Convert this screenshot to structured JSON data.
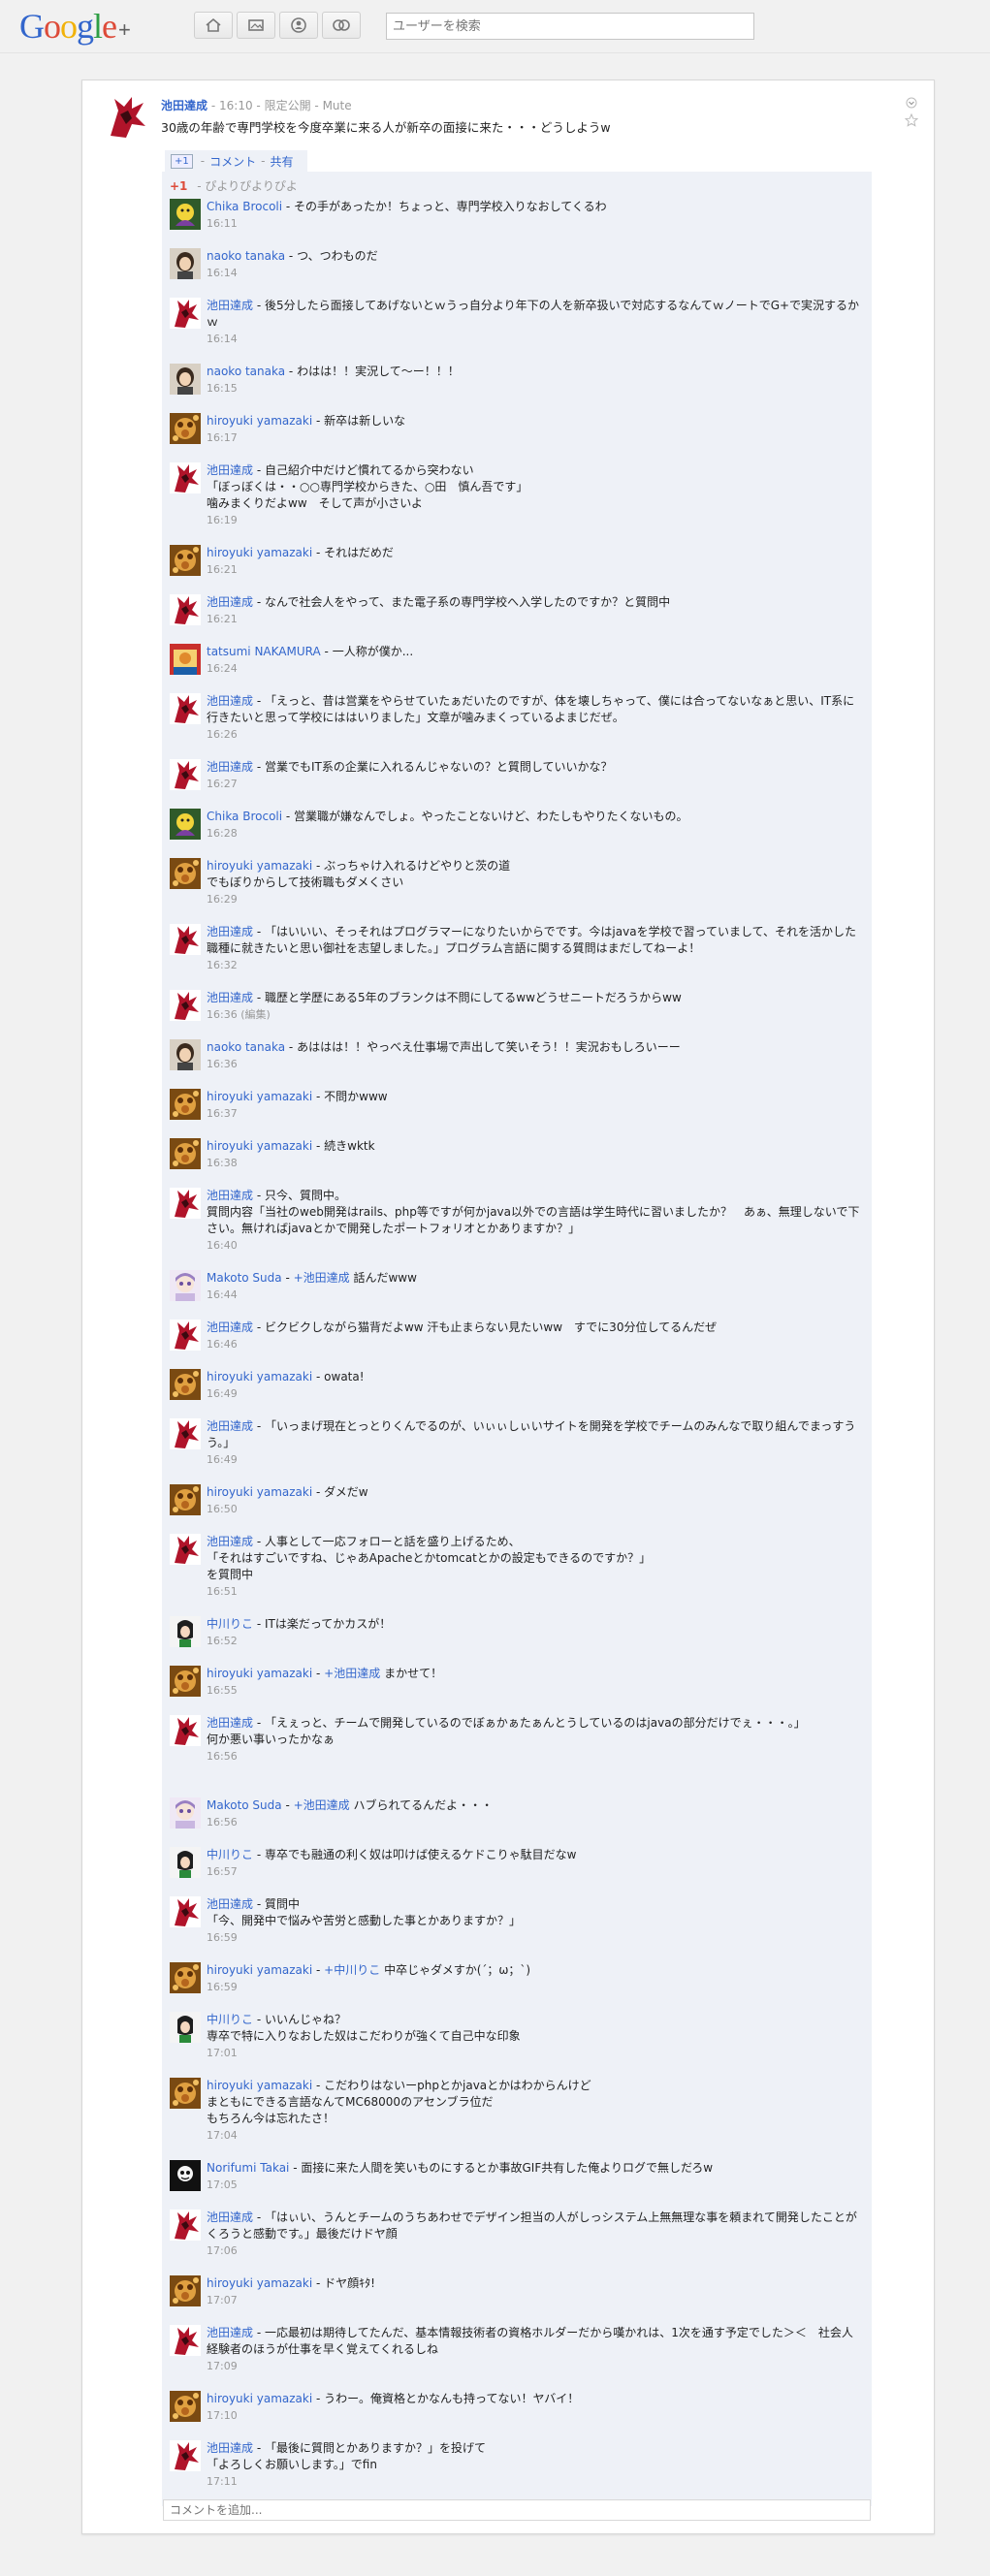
{
  "header": {
    "logo_letters": [
      "G",
      "o",
      "o",
      "g",
      "l",
      "e"
    ],
    "logo_colors": [
      "#3366cc",
      "#dd4b39",
      "#f1b20a",
      "#3366cc",
      "#2e9e44",
      "#dd4b39"
    ],
    "logo_plus": "+",
    "nav_icons": [
      "home-icon",
      "photos-icon",
      "profile-icon",
      "circles-icon"
    ],
    "search_placeholder": "ユーザーを検索"
  },
  "post": {
    "author": "池田達成",
    "time": "16:10",
    "visibility": "限定公開",
    "mute": "Mute",
    "text": "30歳の年齢で専門学校を今度卒業に来る人が新卒の面接に来た・・・どうしようw",
    "plusone_label": "+1",
    "comment_link": "コメント",
    "share_link": "共有",
    "plusones_label": "+1",
    "plusones_names": "ぴよりぴよりぴよ"
  },
  "comment_input_placeholder": "コメントを追加...",
  "comments": [
    {
      "author": "Chika Brocoli",
      "avatar": "chika",
      "mention": "",
      "lines": [
        "その手があったか！ちょっと、専門学校入りなおしてくるわ"
      ],
      "time": "16:11"
    },
    {
      "author": "naoko tanaka",
      "avatar": "naoko",
      "mention": "",
      "lines": [
        "つ、つわものだ"
      ],
      "time": "16:14"
    },
    {
      "author": "池田達成",
      "avatar": "ikeda",
      "mention": "",
      "lines": [
        "後5分したら面接してあげないとｗうっ自分より年下の人を新卒扱いで対応するなんてｗノートでG+で実況するかｗ"
      ],
      "time": "16:14"
    },
    {
      "author": "naoko tanaka",
      "avatar": "naoko",
      "mention": "",
      "lines": [
        "わはは！！実況して〜ー！！！"
      ],
      "time": "16:15"
    },
    {
      "author": "hiroyuki yamazaki",
      "avatar": "hiroyuki",
      "mention": "",
      "lines": [
        "新卒は新しいな"
      ],
      "time": "16:17"
    },
    {
      "author": "池田達成",
      "avatar": "ikeda",
      "mention": "",
      "lines": [
        "自己紹介中だけど慣れてるから突わない",
        "「ぼっぼくは・・○○専門学校からきた、○田　慎ん吾です」",
        "噛みまくりだよww　そして声が小さいよ"
      ],
      "time": "16:19"
    },
    {
      "author": "hiroyuki yamazaki",
      "avatar": "hiroyuki",
      "mention": "",
      "lines": [
        "それはだめだ"
      ],
      "time": "16:21"
    },
    {
      "author": "池田達成",
      "avatar": "ikeda",
      "mention": "",
      "lines": [
        "なんで社会人をやって、また電子系の専門学校へ入学したのですか？と質問中"
      ],
      "time": "16:21"
    },
    {
      "author": "tatsumi NAKAMURA",
      "avatar": "tatsumi",
      "mention": "",
      "lines": [
        "一人称が僕か..."
      ],
      "time": "16:24"
    },
    {
      "author": "池田達成",
      "avatar": "ikeda",
      "mention": "",
      "lines": [
        "「えっと、昔は営業をやらせていたぁだいたのですが、体を壊しちゃって、僕には合ってないなぁと思い、IT系に行きたいと思って学校にははいりました」文章が噛みまくっているよまじだぜ。"
      ],
      "time": "16:26"
    },
    {
      "author": "池田達成",
      "avatar": "ikeda",
      "mention": "",
      "lines": [
        "営業でもIT系の企業に入れるんじゃないの？と質問していいかな？"
      ],
      "time": "16:27"
    },
    {
      "author": "Chika Brocoli",
      "avatar": "chika",
      "mention": "",
      "lines": [
        "営業職が嫌なんでしょ。やったことないけど、わたしもやりたくないもの。"
      ],
      "time": "16:28"
    },
    {
      "author": "hiroyuki yamazaki",
      "avatar": "hiroyuki",
      "mention": "",
      "lines": [
        "ぶっちゃけ入れるけどやりと茨の道",
        "でもぼりからして技術職もダメくさい"
      ],
      "time": "16:29"
    },
    {
      "author": "池田達成",
      "avatar": "ikeda",
      "mention": "",
      "lines": [
        "「はいいい、そっそれはプログラマーになりたいからでです。今はjavaを学校で習っていまして、それを活かした職種に就きたいと思い御社を志望しました。」プログラム言語に関する質問はまだしてねーよ！"
      ],
      "time": "16:32"
    },
    {
      "author": "池田達成",
      "avatar": "ikeda",
      "mention": "",
      "lines": [
        "職歴と学歴にある5年のブランクは不問にしてるwwどうせニートだろうからww"
      ],
      "time": "16:36 (編集)"
    },
    {
      "author": "naoko tanaka",
      "avatar": "naoko",
      "mention": "",
      "lines": [
        "あははは！！やっべえ仕事場で声出して笑いそう！！実況おもしろいーー"
      ],
      "time": "16:36"
    },
    {
      "author": "hiroyuki yamazaki",
      "avatar": "hiroyuki",
      "mention": "",
      "lines": [
        "不問かwww"
      ],
      "time": "16:37"
    },
    {
      "author": "hiroyuki yamazaki",
      "avatar": "hiroyuki",
      "mention": "",
      "lines": [
        "続きwktk"
      ],
      "time": "16:38"
    },
    {
      "author": "池田達成",
      "avatar": "ikeda",
      "mention": "",
      "lines": [
        "只今、質問中。",
        "質問内容「当社のweb開発はrails、php等ですが何かjava以外での言語は学生時代に習いましたか？　あぁ、無理しないで下さい。無ければjavaとかで開発したポートフォリオとかありますか？」"
      ],
      "time": "16:40"
    },
    {
      "author": "Makoto Suda",
      "avatar": "makoto",
      "mention": "+池田達成",
      "lines": [
        "話んだwww"
      ],
      "time": "16:44"
    },
    {
      "author": "池田達成",
      "avatar": "ikeda",
      "mention": "",
      "lines": [
        "ビクビクしながら猫背だよww 汗も止まらない見たいww　すでに30分位してるんだぜ"
      ],
      "time": "16:46"
    },
    {
      "author": "hiroyuki yamazaki",
      "avatar": "hiroyuki",
      "mention": "",
      "lines": [
        "owata!"
      ],
      "time": "16:49"
    },
    {
      "author": "池田達成",
      "avatar": "ikeda",
      "mention": "",
      "lines": [
        "「いっまげ現在とっとりくんでるのが、いぃぃしぃいサイトを開発を学校でチームのみんなで取り組んでまっすうう。」"
      ],
      "time": "16:49"
    },
    {
      "author": "hiroyuki yamazaki",
      "avatar": "hiroyuki",
      "mention": "",
      "lines": [
        "ダメだw"
      ],
      "time": "16:50"
    },
    {
      "author": "池田達成",
      "avatar": "ikeda",
      "mention": "",
      "lines": [
        "人事として一応フォローと話を盛り上げるため、",
        "「それはすごいですね、じゃあApacheとかtomcatとかの設定もできるのですか？」",
        "を質問中"
      ],
      "time": "16:51"
    },
    {
      "author": "中川りこ",
      "avatar": "riko",
      "mention": "",
      "lines": [
        "ITは楽だってかカスが！"
      ],
      "time": "16:52"
    },
    {
      "author": "hiroyuki yamazaki",
      "avatar": "hiroyuki",
      "mention": "+池田達成",
      "lines": [
        "まかせて！"
      ],
      "time": "16:55"
    },
    {
      "author": "池田達成",
      "avatar": "ikeda",
      "mention": "",
      "lines": [
        "「えぇっと、チームで開発しているのでぼぁかぁたぁんとうしているのはjavaの部分だけでぇ・・・。」",
        "何か悪い事いったかなぁ"
      ],
      "time": "16:56"
    },
    {
      "author": "Makoto Suda",
      "avatar": "makoto",
      "mention": "+池田達成",
      "lines": [
        "ハブられてるんだよ・・・"
      ],
      "time": "16:56"
    },
    {
      "author": "中川りこ",
      "avatar": "riko",
      "mention": "",
      "lines": [
        "専卒でも融通の利く奴は叩けば使えるケドこりゃ駄目だなw"
      ],
      "time": "16:57"
    },
    {
      "author": "池田達成",
      "avatar": "ikeda",
      "mention": "",
      "lines": [
        "質問中",
        "「今、開発中で悩みや苦労と感動した事とかありますか？」"
      ],
      "time": "16:59"
    },
    {
      "author": "hiroyuki yamazaki",
      "avatar": "hiroyuki",
      "mention": "+中川りこ",
      "lines": [
        "中卒じゃダメすか(´；ω；`)"
      ],
      "time": "16:59"
    },
    {
      "author": "中川りこ",
      "avatar": "riko",
      "mention": "",
      "lines": [
        "いいんじゃね？",
        "専卒で特に入りなおした奴はこだわりが強くて自己中な印象"
      ],
      "time": "17:01"
    },
    {
      "author": "hiroyuki yamazaki",
      "avatar": "hiroyuki",
      "mention": "",
      "lines": [
        "こだわりはないーphpとかjavaとかはわからんけど",
        "まともにできる言語なんてMC68000のアセンブラ位だ",
        "もちろん今は忘れたさ！"
      ],
      "time": "17:04"
    },
    {
      "author": "Norifumi Takai",
      "avatar": "norifumi",
      "mention": "",
      "lines": [
        "面接に来た人間を笑いものにするとか事故GIF共有した俺よりログで無しだろw"
      ],
      "time": "17:05"
    },
    {
      "author": "池田達成",
      "avatar": "ikeda",
      "mention": "",
      "lines": [
        "「はぃい、うんとチームのうちあわせでデザイン担当の人がしっシステム上無無理な事を頼まれて開発したことがくろうと感動です。」最後だけドヤ顔"
      ],
      "time": "17:06"
    },
    {
      "author": "hiroyuki yamazaki",
      "avatar": "hiroyuki",
      "mention": "",
      "lines": [
        "ドヤ顔ｷﾀ!"
      ],
      "time": "17:07"
    },
    {
      "author": "池田達成",
      "avatar": "ikeda",
      "mention": "",
      "lines": [
        "一応最初は期待してたんだ、基本情報技術者の資格ホルダーだから嘆かれは、1次を通す予定でした＞＜　社会人経験者のほうが仕事を早く覚えてくれるしね"
      ],
      "time": "17:09"
    },
    {
      "author": "hiroyuki yamazaki",
      "avatar": "hiroyuki",
      "mention": "",
      "lines": [
        "うわー。俺資格とかなんも持ってない！ヤバイ！"
      ],
      "time": "17:10"
    },
    {
      "author": "池田達成",
      "avatar": "ikeda",
      "mention": "",
      "lines": [
        "「最後に質問とかありますか？」を投げて",
        "「よろしくお願いします。」でfin"
      ],
      "time": "17:11"
    }
  ]
}
